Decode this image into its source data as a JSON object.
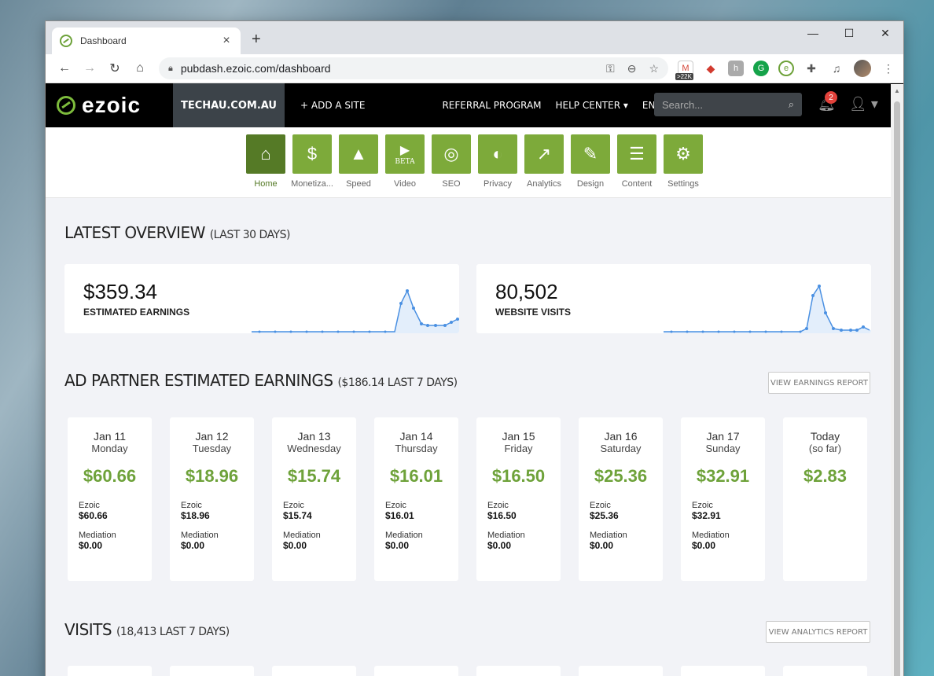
{
  "browser": {
    "tab_title": "Dashboard",
    "url": "pubdash.ezoic.com/dashboard",
    "ext_badge": ">22K"
  },
  "header": {
    "logo": "ezoic",
    "site": "TECHAU.COM.AU",
    "add_site": "+ ADD A SITE",
    "referral": "REFERRAL PROGRAM",
    "help": "HELP CENTER",
    "language": "ENGLISH",
    "search_placeholder": "Search...",
    "notif_count": "2"
  },
  "apps": [
    {
      "label": "Home",
      "icon": "home-icon",
      "glyph": "⌂"
    },
    {
      "label": "Monetiza...",
      "icon": "dollar-icon",
      "glyph": "$"
    },
    {
      "label": "Speed",
      "icon": "rocket-icon",
      "glyph": "▲"
    },
    {
      "label": "Video",
      "icon": "video-icon",
      "glyph": "▶"
    },
    {
      "label": "SEO",
      "icon": "magnifier-icon",
      "glyph": "◎"
    },
    {
      "label": "Privacy",
      "icon": "shield-icon",
      "glyph": "◐"
    },
    {
      "label": "Analytics",
      "icon": "chart-icon",
      "glyph": "↗"
    },
    {
      "label": "Design",
      "icon": "design-icon",
      "glyph": "✎"
    },
    {
      "label": "Content",
      "icon": "content-icon",
      "glyph": "☰"
    },
    {
      "label": "Settings",
      "icon": "gear-icon",
      "glyph": "⚙"
    }
  ],
  "video_beta": "BETA",
  "overview": {
    "title": "LATEST OVERVIEW",
    "sub": "(LAST 30 DAYS)",
    "earnings_value": "$359.34",
    "earnings_label": "ESTIMATED EARNINGS",
    "visits_value": "80,502",
    "visits_label": "WEBSITE VISITS"
  },
  "adpartner": {
    "title": "AD PARTNER ESTIMATED EARNINGS",
    "sub": "($186.14 LAST 7 DAYS)",
    "button": "VIEW EARNINGS REPORT",
    "ezoic_label": "Ezoic",
    "mediation_label": "Mediation",
    "days": [
      {
        "date": "Jan 11",
        "weekday": "Monday",
        "total": "$60.66",
        "ezoic": "$60.66",
        "mediation": "$0.00"
      },
      {
        "date": "Jan 12",
        "weekday": "Tuesday",
        "total": "$18.96",
        "ezoic": "$18.96",
        "mediation": "$0.00"
      },
      {
        "date": "Jan 13",
        "weekday": "Wednesday",
        "total": "$15.74",
        "ezoic": "$15.74",
        "mediation": "$0.00"
      },
      {
        "date": "Jan 14",
        "weekday": "Thursday",
        "total": "$16.01",
        "ezoic": "$16.01",
        "mediation": "$0.00"
      },
      {
        "date": "Jan 15",
        "weekday": "Friday",
        "total": "$16.50",
        "ezoic": "$16.50",
        "mediation": "$0.00"
      },
      {
        "date": "Jan 16",
        "weekday": "Saturday",
        "total": "$25.36",
        "ezoic": "$25.36",
        "mediation": "$0.00"
      },
      {
        "date": "Jan 17",
        "weekday": "Sunday",
        "total": "$32.91",
        "ezoic": "$32.91",
        "mediation": "$0.00"
      },
      {
        "date": "Today",
        "weekday": "(so far)",
        "total": "$2.83"
      }
    ]
  },
  "visits": {
    "title": "VISITS",
    "sub": "(18,413 LAST 7 DAYS)",
    "button": "VIEW ANALYTICS REPORT"
  },
  "colors": {
    "accent": "#7daa3a",
    "accent_dark": "#557a26",
    "money": "#6ea23a",
    "spark": "#4a90e2"
  }
}
